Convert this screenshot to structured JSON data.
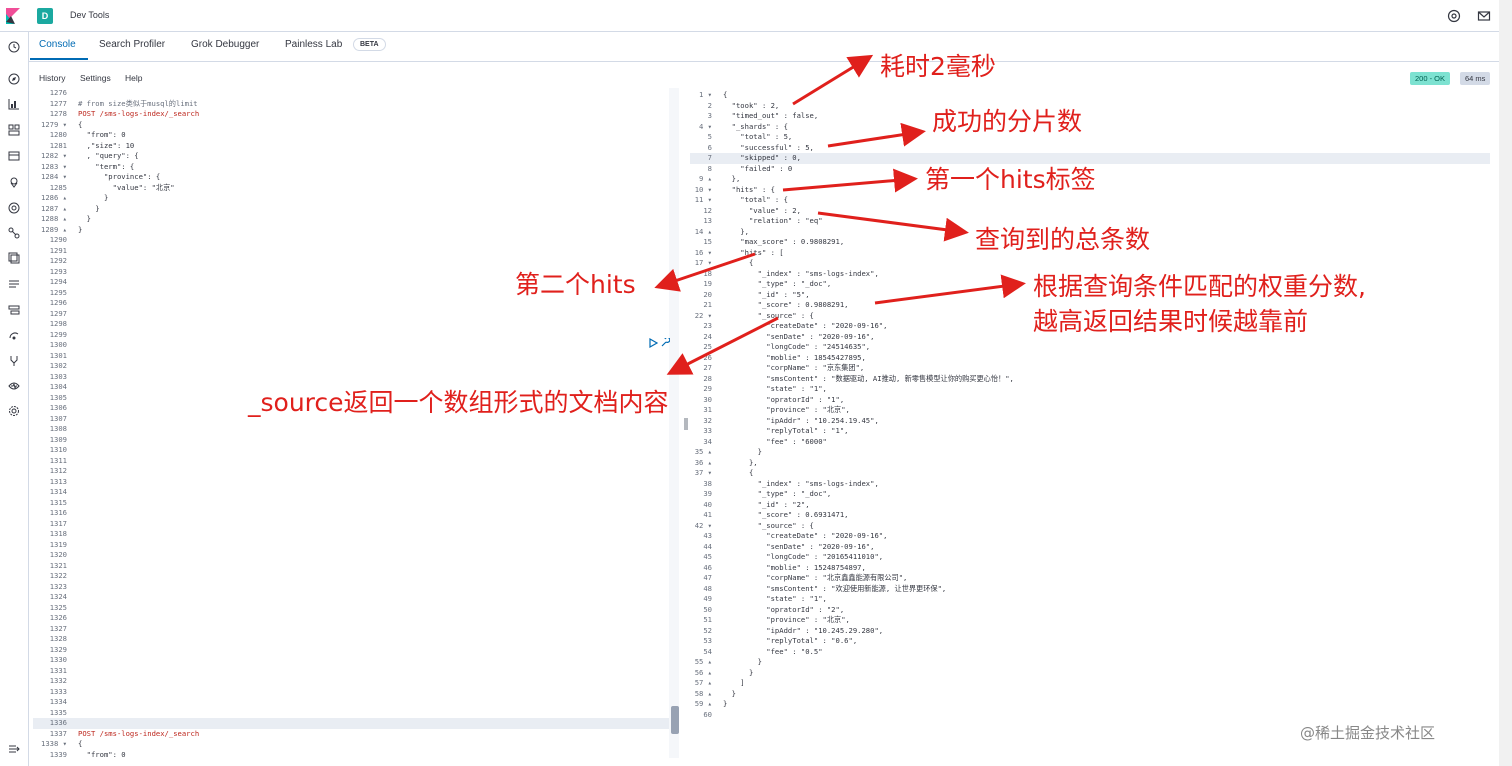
{
  "header": {
    "app_badge": "D",
    "title": "Dev Tools"
  },
  "tabs": [
    {
      "label": "Console"
    },
    {
      "label": "Search Profiler"
    },
    {
      "label": "Grok Debugger"
    },
    {
      "label": "Painless Lab"
    }
  ],
  "beta_label": "BETA",
  "subnav": {
    "history": "History",
    "settings": "Settings",
    "help": "Help"
  },
  "status": {
    "code": "200 - OK",
    "time": "64 ms"
  },
  "left_editor": {
    "lines": [
      {
        "n": "1276",
        "t": ""
      },
      {
        "n": "1277",
        "t": "# from size类似于musql的limit",
        "cls": "comment"
      },
      {
        "n": "1278",
        "t": "POST /sms-logs-index/_search",
        "cls": "method"
      },
      {
        "n": "1279 ▾",
        "t": "{"
      },
      {
        "n": "1280",
        "t": "  \"from\": 0"
      },
      {
        "n": "1281",
        "t": "  ,\"size\": 10"
      },
      {
        "n": "1282 ▾",
        "t": "  , \"query\": {"
      },
      {
        "n": "1283 ▾",
        "t": "    \"term\": {"
      },
      {
        "n": "1284 ▾",
        "t": "      \"province\": {"
      },
      {
        "n": "1285",
        "t": "        \"value\": \"北京\""
      },
      {
        "n": "1286 ▴",
        "t": "      }"
      },
      {
        "n": "1287 ▴",
        "t": "    }"
      },
      {
        "n": "1288 ▴",
        "t": "  }"
      },
      {
        "n": "1289 ▴",
        "t": "}"
      },
      {
        "n": "1290",
        "t": ""
      },
      {
        "n": "1291",
        "t": ""
      },
      {
        "n": "1292",
        "t": ""
      },
      {
        "n": "1293",
        "t": ""
      },
      {
        "n": "1294",
        "t": ""
      },
      {
        "n": "1295",
        "t": ""
      },
      {
        "n": "1296",
        "t": ""
      },
      {
        "n": "1297",
        "t": ""
      },
      {
        "n": "1298",
        "t": ""
      },
      {
        "n": "1299",
        "t": ""
      },
      {
        "n": "1300",
        "t": ""
      },
      {
        "n": "1301",
        "t": ""
      },
      {
        "n": "1302",
        "t": ""
      },
      {
        "n": "1303",
        "t": ""
      },
      {
        "n": "1304",
        "t": ""
      },
      {
        "n": "1305",
        "t": ""
      },
      {
        "n": "1306",
        "t": ""
      },
      {
        "n": "1307",
        "t": ""
      },
      {
        "n": "1308",
        "t": ""
      },
      {
        "n": "1309",
        "t": ""
      },
      {
        "n": "1310",
        "t": ""
      },
      {
        "n": "1311",
        "t": ""
      },
      {
        "n": "1312",
        "t": ""
      },
      {
        "n": "1313",
        "t": ""
      },
      {
        "n": "1314",
        "t": ""
      },
      {
        "n": "1315",
        "t": ""
      },
      {
        "n": "1316",
        "t": ""
      },
      {
        "n": "1317",
        "t": ""
      },
      {
        "n": "1318",
        "t": ""
      },
      {
        "n": "1319",
        "t": ""
      },
      {
        "n": "1320",
        "t": ""
      },
      {
        "n": "1321",
        "t": ""
      },
      {
        "n": "1322",
        "t": ""
      },
      {
        "n": "1323",
        "t": ""
      },
      {
        "n": "1324",
        "t": ""
      },
      {
        "n": "1325",
        "t": ""
      },
      {
        "n": "1326",
        "t": ""
      },
      {
        "n": "1327",
        "t": ""
      },
      {
        "n": "1328",
        "t": ""
      },
      {
        "n": "1329",
        "t": ""
      },
      {
        "n": "1330",
        "t": ""
      },
      {
        "n": "1331",
        "t": ""
      },
      {
        "n": "1332",
        "t": ""
      },
      {
        "n": "1333",
        "t": ""
      },
      {
        "n": "1334",
        "t": ""
      },
      {
        "n": "1335",
        "t": ""
      },
      {
        "n": "1336",
        "t": "",
        "hl": true
      },
      {
        "n": "1337",
        "t": "POST /sms-logs-index/_search",
        "cls": "method"
      },
      {
        "n": "1338 ▾",
        "t": "{"
      },
      {
        "n": "1339",
        "t": "  \"from\": 0"
      }
    ]
  },
  "right_editor": {
    "lines": [
      {
        "n": "1 ▾",
        "t": "{"
      },
      {
        "n": "2",
        "t": "  \"took\" : 2,"
      },
      {
        "n": "3",
        "t": "  \"timed_out\" : false,"
      },
      {
        "n": "4 ▾",
        "t": "  \"_shards\" : {"
      },
      {
        "n": "5",
        "t": "    \"total\" : 5,"
      },
      {
        "n": "6",
        "t": "    \"successful\" : 5,"
      },
      {
        "n": "7",
        "t": "    \"skipped\" : 0,",
        "hl": true
      },
      {
        "n": "8",
        "t": "    \"failed\" : 0"
      },
      {
        "n": "9 ▴",
        "t": "  },"
      },
      {
        "n": "10 ▾",
        "t": "  \"hits\" : {"
      },
      {
        "n": "11 ▾",
        "t": "    \"total\" : {"
      },
      {
        "n": "12",
        "t": "      \"value\" : 2,"
      },
      {
        "n": "13",
        "t": "      \"relation\" : \"eq\""
      },
      {
        "n": "14 ▴",
        "t": "    },"
      },
      {
        "n": "15",
        "t": "    \"max_score\" : 0.9808291,"
      },
      {
        "n": "16 ▾",
        "t": "    \"hits\" : ["
      },
      {
        "n": "17 ▾",
        "t": "      {"
      },
      {
        "n": "18",
        "t": "        \"_index\" : \"sms-logs-index\","
      },
      {
        "n": "19",
        "t": "        \"_type\" : \"_doc\","
      },
      {
        "n": "20",
        "t": "        \"_id\" : \"5\","
      },
      {
        "n": "21",
        "t": "        \"_score\" : 0.9808291,"
      },
      {
        "n": "22 ▾",
        "t": "        \"_source\" : {"
      },
      {
        "n": "23",
        "t": "          \"createDate\" : \"2020-09-16\","
      },
      {
        "n": "24",
        "t": "          \"senDate\" : \"2020-09-16\","
      },
      {
        "n": "25",
        "t": "          \"longCode\" : \"24514635\","
      },
      {
        "n": "26",
        "t": "          \"moblie\" : 18545427895,"
      },
      {
        "n": "27",
        "t": "          \"corpName\" : \"京东集团\","
      },
      {
        "n": "28",
        "t": "          \"smsContent\" : \"数据驱动, AI推动, 新零售模型让你的购买更心怡！\","
      },
      {
        "n": "29",
        "t": "          \"state\" : \"1\","
      },
      {
        "n": "30",
        "t": "          \"opratorId\" : \"1\","
      },
      {
        "n": "31",
        "t": "          \"province\" : \"北京\","
      },
      {
        "n": "32",
        "t": "          \"ipAddr\" : \"10.254.19.45\","
      },
      {
        "n": "33",
        "t": "          \"replyTotal\" : \"1\","
      },
      {
        "n": "34",
        "t": "          \"fee\" : \"6000\""
      },
      {
        "n": "35 ▴",
        "t": "        }"
      },
      {
        "n": "36 ▴",
        "t": "      },"
      },
      {
        "n": "37 ▾",
        "t": "      {"
      },
      {
        "n": "38",
        "t": "        \"_index\" : \"sms-logs-index\","
      },
      {
        "n": "39",
        "t": "        \"_type\" : \"_doc\","
      },
      {
        "n": "40",
        "t": "        \"_id\" : \"2\","
      },
      {
        "n": "41",
        "t": "        \"_score\" : 0.6931471,"
      },
      {
        "n": "42 ▾",
        "t": "        \"_source\" : {"
      },
      {
        "n": "43",
        "t": "          \"createDate\" : \"2020-09-16\","
      },
      {
        "n": "44",
        "t": "          \"senDate\" : \"2020-09-16\","
      },
      {
        "n": "45",
        "t": "          \"longCode\" : \"20165411010\","
      },
      {
        "n": "46",
        "t": "          \"moblie\" : 15248754897,"
      },
      {
        "n": "47",
        "t": "          \"corpName\" : \"北京鑫鑫能源有限公司\","
      },
      {
        "n": "48",
        "t": "          \"smsContent\" : \"欢迎使用新能源, 让世界更环保\","
      },
      {
        "n": "49",
        "t": "          \"state\" : \"1\","
      },
      {
        "n": "50",
        "t": "          \"opratorId\" : \"2\","
      },
      {
        "n": "51",
        "t": "          \"province\" : \"北京\","
      },
      {
        "n": "52",
        "t": "          \"ipAddr\" : \"10.245.29.280\","
      },
      {
        "n": "53",
        "t": "          \"replyTotal\" : \"0.6\","
      },
      {
        "n": "54",
        "t": "          \"fee\" : \"0.5\""
      },
      {
        "n": "55 ▴",
        "t": "        }"
      },
      {
        "n": "56 ▴",
        "t": "      }"
      },
      {
        "n": "57 ▴",
        "t": "    ]"
      },
      {
        "n": "58 ▴",
        "t": "  }"
      },
      {
        "n": "59 ▴",
        "t": "}"
      },
      {
        "n": "60",
        "t": ""
      }
    ]
  },
  "annotations": {
    "took": "耗时2毫秒",
    "shards": "成功的分片数",
    "first_hits": "第一个hits标签",
    "total": "查询到的总条数",
    "second_hits": "第二个hits",
    "score_line1": "根据查询条件匹配的权重分数,",
    "score_line2": "越高返回结果时候越靠前",
    "source": "_source返回一个数组形式的文档内容"
  },
  "watermark": "@稀土掘金技术社区",
  "colors": {
    "accent": "#006bb4",
    "annotation_red": "#e0201c",
    "status_ok_bg": "#7de2d1"
  }
}
